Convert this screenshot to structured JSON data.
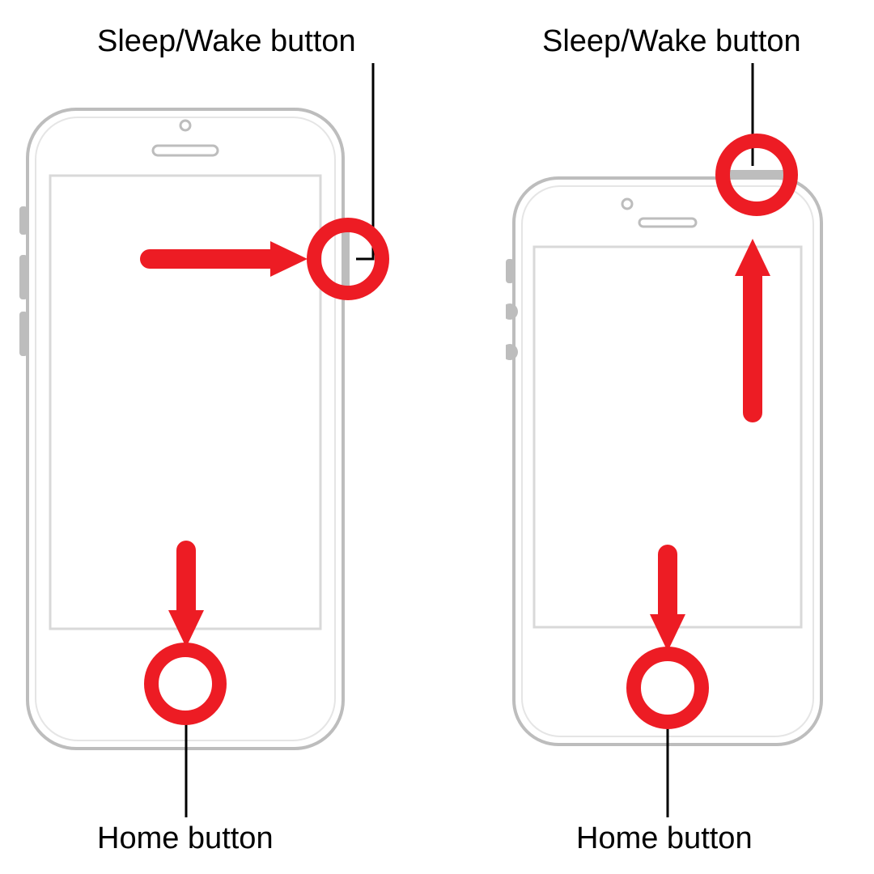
{
  "colors": {
    "red": "#ED1C24",
    "line": "#BDBDBD",
    "text": "#000000"
  },
  "labels": {
    "left_sleep": "Sleep/Wake button",
    "right_sleep": "Sleep/Wake button",
    "left_home": "Home button",
    "right_home": "Home button"
  }
}
